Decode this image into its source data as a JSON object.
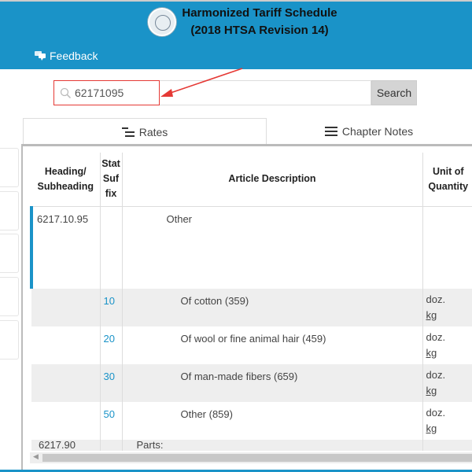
{
  "header": {
    "title_line1": "Harmonized Tariff Schedule",
    "title_line2": "(2018 HTSA Revision 14)",
    "feedback": "Feedback",
    "color": "#1a93c8"
  },
  "search": {
    "value": "62171095",
    "button": "Search"
  },
  "tabs": [
    {
      "label": "Rates",
      "icon": "list-indent-icon"
    },
    {
      "label": "Chapter Notes",
      "icon": "menu-icon"
    }
  ],
  "table": {
    "headers": [
      "Heading/ Subheading",
      "Stat Suf fix",
      "Article Description",
      "Unit of Quantity"
    ],
    "rows": [
      {
        "heading": "6217.10.95",
        "stat": "",
        "desc": "Other",
        "unit1": "",
        "unit2": ""
      },
      {
        "heading": "",
        "stat": "10",
        "desc": "Of cotton (359)",
        "unit1": "doz.",
        "unit2": "kg"
      },
      {
        "heading": "",
        "stat": "20",
        "desc": "Of wool or fine animal hair (459)",
        "unit1": "doz.",
        "unit2": "kg"
      },
      {
        "heading": "",
        "stat": "30",
        "desc": "Of man-made fibers (659)",
        "unit1": "doz.",
        "unit2": "kg"
      },
      {
        "heading": "",
        "stat": "50",
        "desc": "Other (859)",
        "unit1": "doz.",
        "unit2": "kg"
      },
      {
        "heading": "6217.90",
        "stat": "",
        "desc": "Parts:",
        "unit1": "",
        "unit2": ""
      }
    ]
  }
}
